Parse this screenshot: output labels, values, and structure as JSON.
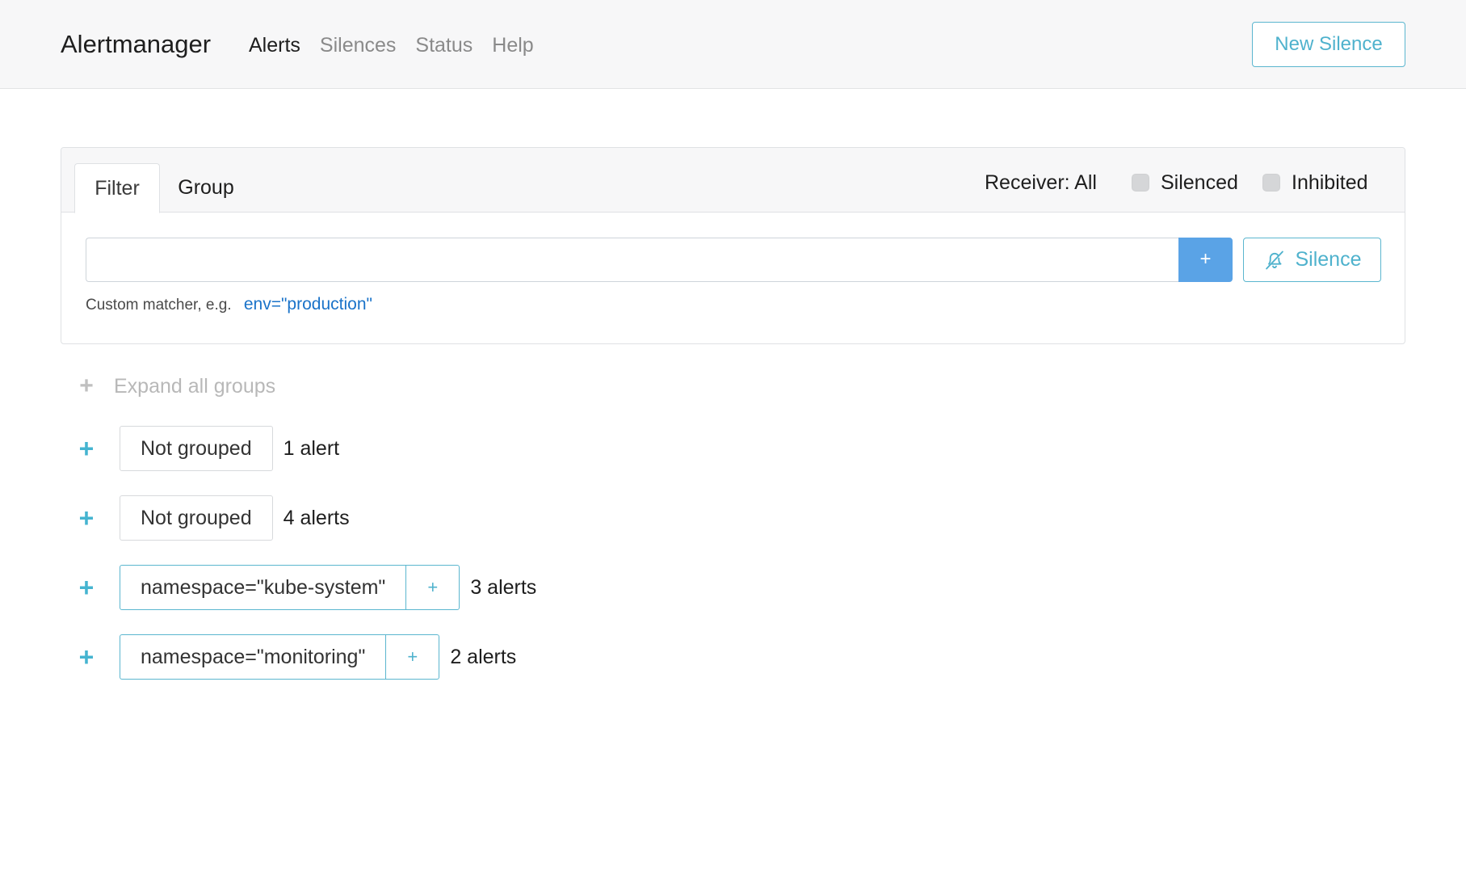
{
  "navbar": {
    "brand": "Alertmanager",
    "links": [
      "Alerts",
      "Silences",
      "Status",
      "Help"
    ],
    "active": "Alerts",
    "new_silence_label": "New Silence"
  },
  "filter_card": {
    "tabs": [
      "Filter",
      "Group"
    ],
    "active_tab": "Filter",
    "receiver_label": "Receiver: All",
    "checkboxes": [
      {
        "label": "Silenced",
        "checked": false
      },
      {
        "label": "Inhibited",
        "checked": false
      }
    ],
    "input_value": "",
    "add_button_label": "+",
    "silence_button_label": "Silence",
    "hint_text": "Custom matcher, e.g.",
    "hint_example": "env=\"production\""
  },
  "groups": {
    "expand_all_label": "Expand all groups",
    "items": [
      {
        "label": "Not grouped",
        "count": "1 alert",
        "has_add": false
      },
      {
        "label": "Not grouped",
        "count": "4 alerts",
        "has_add": false
      },
      {
        "label": "namespace=\"kube-system\"",
        "count": "3 alerts",
        "has_add": true,
        "add_label": "+"
      },
      {
        "label": "namespace=\"monitoring\"",
        "count": "2 alerts",
        "has_add": true,
        "add_label": "+"
      }
    ]
  },
  "colors": {
    "accent_teal": "#4fb2cd",
    "primary_blue": "#5aa3e6",
    "link_blue": "#1a73c9",
    "navbar_bg": "#f7f7f8"
  },
  "icons": {
    "silence_button": "bell-slash-icon",
    "expand": "plus-icon"
  }
}
